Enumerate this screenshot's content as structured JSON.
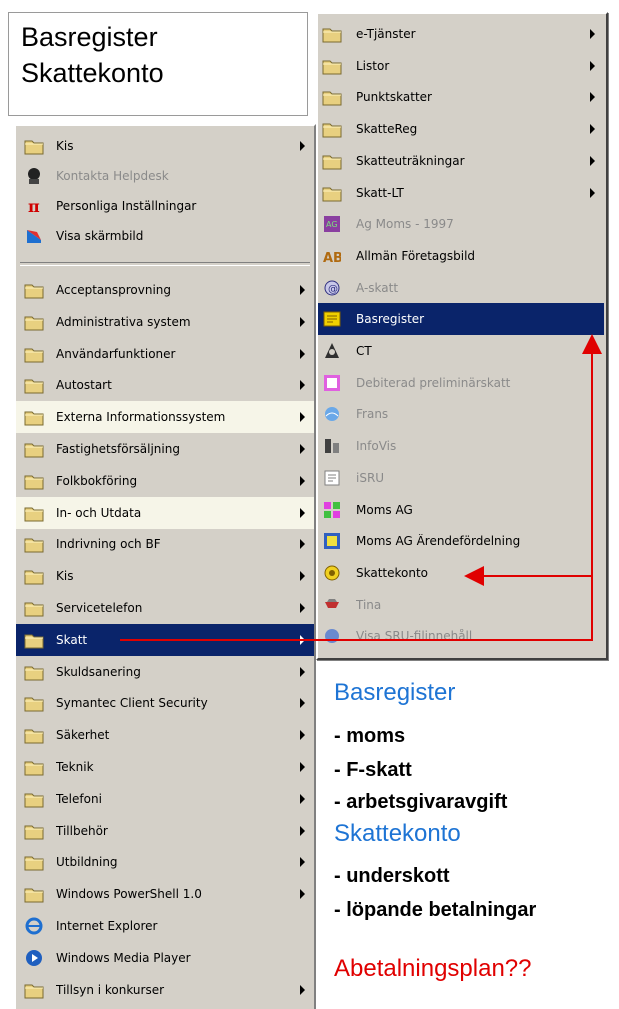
{
  "title_box": {
    "line1": "Basregister",
    "line2": "Skattekonto"
  },
  "left_menu": {
    "top_items": [
      {
        "label": "Kis",
        "icon": "folder-icon",
        "arrow": true
      },
      {
        "label": "Kontakta Helpdesk",
        "icon": "helpdesk-icon",
        "arrow": false,
        "disabled": true
      },
      {
        "label": "Personliga Inställningar",
        "icon": "pi-icon",
        "arrow": false
      },
      {
        "label": "Visa skärmbild",
        "icon": "screenshot-icon",
        "arrow": false
      }
    ],
    "items": [
      {
        "label": "Acceptansprovning",
        "icon": "folder-icon",
        "arrow": true
      },
      {
        "label": "Administrativa system",
        "icon": "folder-icon",
        "arrow": true
      },
      {
        "label": "Användarfunktioner",
        "icon": "folder-icon",
        "arrow": true
      },
      {
        "label": "Autostart",
        "icon": "folder-icon",
        "arrow": true
      },
      {
        "label": "Externa Informationssystem",
        "icon": "folder-icon",
        "arrow": true,
        "pale": true
      },
      {
        "label": "Fastighetsförsäljning",
        "icon": "folder-icon",
        "arrow": true
      },
      {
        "label": "Folkbokföring",
        "icon": "folder-icon",
        "arrow": true
      },
      {
        "label": "In- och Utdata",
        "icon": "folder-icon",
        "arrow": true,
        "pale": true
      },
      {
        "label": "Indrivning och BF",
        "icon": "folder-icon",
        "arrow": true
      },
      {
        "label": "Kis",
        "icon": "folder-icon",
        "arrow": true
      },
      {
        "label": "Servicetelefon",
        "icon": "folder-icon",
        "arrow": true
      },
      {
        "label": "Skatt",
        "icon": "folder-icon",
        "arrow": true,
        "highlighted": true
      },
      {
        "label": "Skuldsanering",
        "icon": "folder-icon",
        "arrow": true
      },
      {
        "label": "Symantec Client Security",
        "icon": "folder-icon",
        "arrow": true
      },
      {
        "label": "Säkerhet",
        "icon": "folder-icon",
        "arrow": true
      },
      {
        "label": "Teknik",
        "icon": "folder-icon",
        "arrow": true
      },
      {
        "label": "Telefoni",
        "icon": "folder-icon",
        "arrow": true
      },
      {
        "label": "Tillbehör",
        "icon": "folder-icon",
        "arrow": true
      },
      {
        "label": "Utbildning",
        "icon": "folder-icon",
        "arrow": true
      },
      {
        "label": "Windows PowerShell 1.0",
        "icon": "folder-icon",
        "arrow": true
      },
      {
        "label": "Internet Explorer",
        "icon": "ie-icon",
        "arrow": false
      },
      {
        "label": "Windows Media Player",
        "icon": "media-player-icon",
        "arrow": false
      },
      {
        "label": "Tillsyn i konkurser",
        "icon": "folder-icon",
        "arrow": true
      }
    ]
  },
  "right_menu": {
    "items": [
      {
        "label": "e-Tjänster",
        "icon": "folder-icon",
        "arrow": true
      },
      {
        "label": "Listor",
        "icon": "folder-icon",
        "arrow": true
      },
      {
        "label": "Punktskatter",
        "icon": "folder-icon",
        "arrow": true
      },
      {
        "label": "SkatteReg",
        "icon": "folder-icon",
        "arrow": true
      },
      {
        "label": "Skatteuträkningar",
        "icon": "folder-icon",
        "arrow": true
      },
      {
        "label": "Skatt-LT",
        "icon": "folder-icon",
        "arrow": true
      },
      {
        "label": "Ag Moms - 1997",
        "icon": "ag-moms-icon",
        "arrow": false,
        "disabled": true
      },
      {
        "label": "Allmän Företagsbild",
        "icon": "company-icon",
        "arrow": false
      },
      {
        "label": "A-skatt",
        "icon": "a-skatt-icon",
        "arrow": false,
        "disabled": true
      },
      {
        "label": "Basregister",
        "icon": "basregister-icon",
        "arrow": false,
        "highlighted": true
      },
      {
        "label": "CT",
        "icon": "ct-icon",
        "arrow": false
      },
      {
        "label": "Debiterad preliminärskatt",
        "icon": "debit-icon",
        "arrow": false,
        "disabled": true
      },
      {
        "label": "Frans",
        "icon": "frans-icon",
        "arrow": false,
        "disabled": true
      },
      {
        "label": "InfoVis",
        "icon": "infovis-icon",
        "arrow": false,
        "disabled": true
      },
      {
        "label": "iSRU",
        "icon": "isru-icon",
        "arrow": false,
        "disabled": true
      },
      {
        "label": "Moms AG",
        "icon": "moms-ag-icon",
        "arrow": false
      },
      {
        "label": "Moms AG Ärendefördelning",
        "icon": "moms-distribution-icon",
        "arrow": false
      },
      {
        "label": "Skattekonto",
        "icon": "skattekonto-icon",
        "arrow": false
      },
      {
        "label": "Tina",
        "icon": "tina-icon",
        "arrow": false,
        "disabled": true
      },
      {
        "label": "Visa SRU-filinnehåll",
        "icon": "sru-icon",
        "arrow": false,
        "disabled": true
      }
    ]
  },
  "notes": {
    "heading1": "Basregister",
    "item1": "- moms",
    "item2": "- F-skatt",
    "item3": "- arbetsgivaravgift",
    "heading2": "Skattekonto",
    "item4": "- underskott",
    "item5": "- löpande betalningar",
    "question": "Abetalningsplan??"
  },
  "colors": {
    "menu_bg": "#d4d0c8",
    "highlight": "#0a246a",
    "pale_highlight": "#f6f5e8",
    "arrow_red": "#e00000",
    "note_blue": "#1e74d4"
  }
}
